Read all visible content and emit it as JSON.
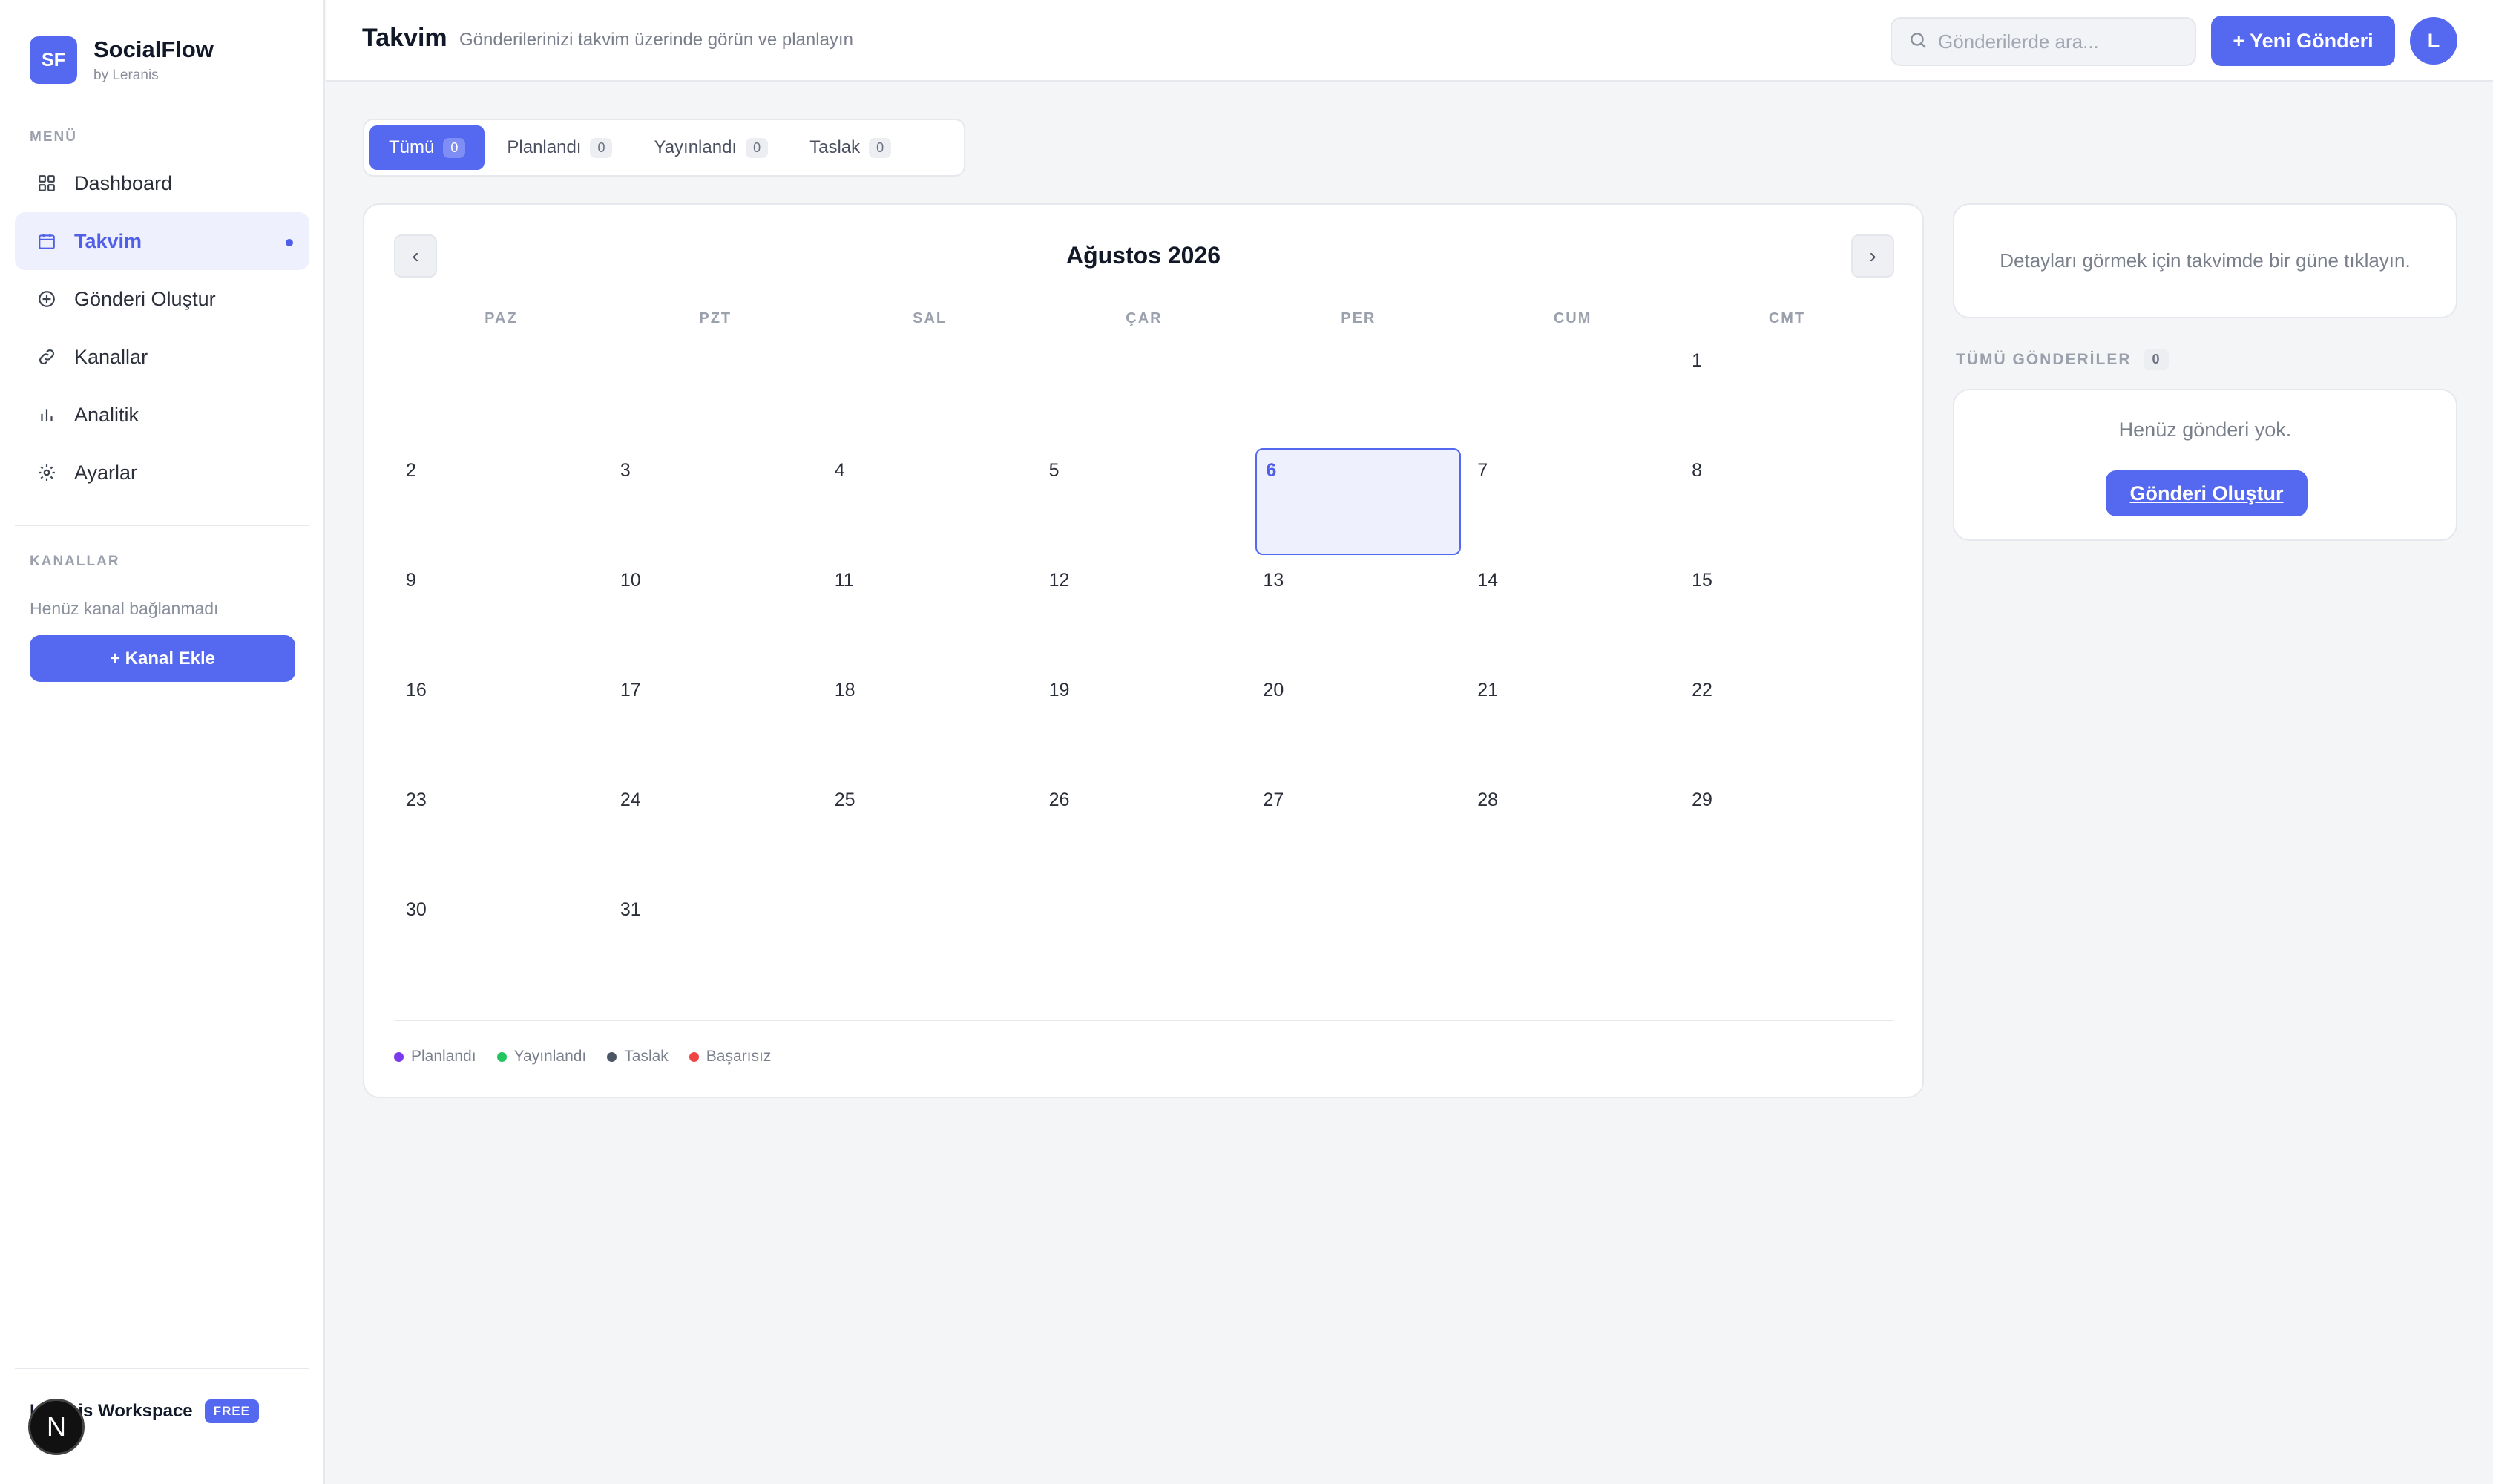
{
  "brand": {
    "logo": "SF",
    "title": "SocialFlow",
    "subtitle": "by Leranis"
  },
  "sidebar": {
    "menu_label": "MENÜ",
    "items": [
      {
        "label": "Dashboard",
        "icon": "grid-icon"
      },
      {
        "label": "Takvim",
        "icon": "calendar-icon",
        "active": true
      },
      {
        "label": "Gönderi Oluştur",
        "icon": "plus-circle-icon"
      },
      {
        "label": "Kanallar",
        "icon": "link-icon"
      },
      {
        "label": "Analitik",
        "icon": "bar-chart-icon"
      },
      {
        "label": "Ayarlar",
        "icon": "gear-icon"
      }
    ],
    "channels_label": "KANALLAR",
    "channels_empty": "Henüz kanal bağlanmadı",
    "add_channel": "+ Kanal Ekle",
    "workspace": "Leranis Workspace",
    "plan_badge": "FREE",
    "corner_badge": "N"
  },
  "header": {
    "title": "Takvim",
    "subtitle": "Gönderilerinizi takvim üzerinde görün ve planlayın",
    "search_placeholder": "Gönderilerde ara...",
    "new_post": "+ Yeni Gönderi",
    "avatar": "L"
  },
  "tabs": [
    {
      "label": "Tümü",
      "count": "0",
      "active": true
    },
    {
      "label": "Planlandı",
      "count": "0"
    },
    {
      "label": "Yayınlandı",
      "count": "0"
    },
    {
      "label": "Taslak",
      "count": "0"
    }
  ],
  "calendar": {
    "prev": "‹",
    "next": "›",
    "month": "Ağustos 2026",
    "weekdays": [
      "PAZ",
      "PZT",
      "SAL",
      "ÇAR",
      "PER",
      "CUM",
      "CMT"
    ],
    "days": [
      "",
      "",
      "",
      "",
      "",
      "",
      "1",
      "2",
      "3",
      "4",
      "5",
      "6",
      "7",
      "8",
      "9",
      "10",
      "11",
      "12",
      "13",
      "14",
      "15",
      "16",
      "17",
      "18",
      "19",
      "20",
      "21",
      "22",
      "23",
      "24",
      "25",
      "26",
      "27",
      "28",
      "29",
      "30",
      "31",
      "",
      "",
      "",
      "",
      ""
    ],
    "selected_day": "6"
  },
  "legend": [
    {
      "label": "Planlandı",
      "color": "#7c3aed"
    },
    {
      "label": "Yayınlandı",
      "color": "#22c55e"
    },
    {
      "label": "Taslak",
      "color": "#4b5563"
    },
    {
      "label": "Başarısız",
      "color": "#ef4444"
    }
  ],
  "details": {
    "hint": "Detayları görmek için takvimde bir güne tıklayın.",
    "posts_label": "TÜMÜ GÖNDERİLER",
    "posts_count": "0",
    "empty": "Henüz gönderi yok.",
    "create": "Gönderi Oluştur"
  },
  "colors": {
    "accent": "#5468f0",
    "accent_soft": "#eef0fd"
  }
}
